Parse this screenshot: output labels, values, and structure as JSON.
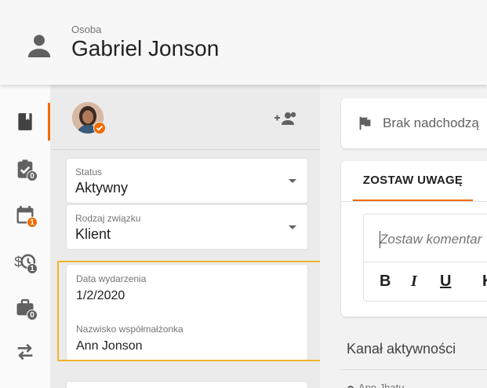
{
  "header": {
    "type_label": "Osoba",
    "name": "Gabriel Jonson"
  },
  "sidebar": {
    "items": [
      {
        "icon": "contact-book-icon",
        "badge": null,
        "active": true
      },
      {
        "icon": "task-check-icon",
        "badge": "0",
        "badge_color": "#616161"
      },
      {
        "icon": "calendar-icon",
        "badge": "1",
        "badge_color": "#ef6c00"
      },
      {
        "icon": "money-clock-icon",
        "badge": "1",
        "badge_color": "#616161"
      },
      {
        "icon": "briefcase-icon",
        "badge": "0",
        "badge_color": "#616161"
      },
      {
        "icon": "transfer-arrows-icon",
        "badge": null
      }
    ]
  },
  "profile": {
    "status": {
      "label": "Status",
      "value": "Aktywny"
    },
    "relationship": {
      "label": "Rodzaj związku",
      "value": "Klient"
    },
    "event_date": {
      "label": "Data wydarzenia",
      "value": "1/2/2020"
    },
    "spouse_name": {
      "label": "Nazwisko współmałżonka",
      "value": "Ann Jonson"
    }
  },
  "next_activity": {
    "text": "Brak nadchodzą"
  },
  "note": {
    "tab_label": "ZOSTAW UWAGĘ",
    "placeholder": "Zostaw komentar",
    "toolbar": {
      "bold": "B",
      "italic": "I",
      "underline": "U",
      "more": "K"
    }
  },
  "activity_feed": {
    "title": "Kanał aktywności",
    "first_item": "Ann Jhatu ..."
  },
  "colors": {
    "accent": "#ef6c00",
    "highlight": "#f0b429"
  }
}
